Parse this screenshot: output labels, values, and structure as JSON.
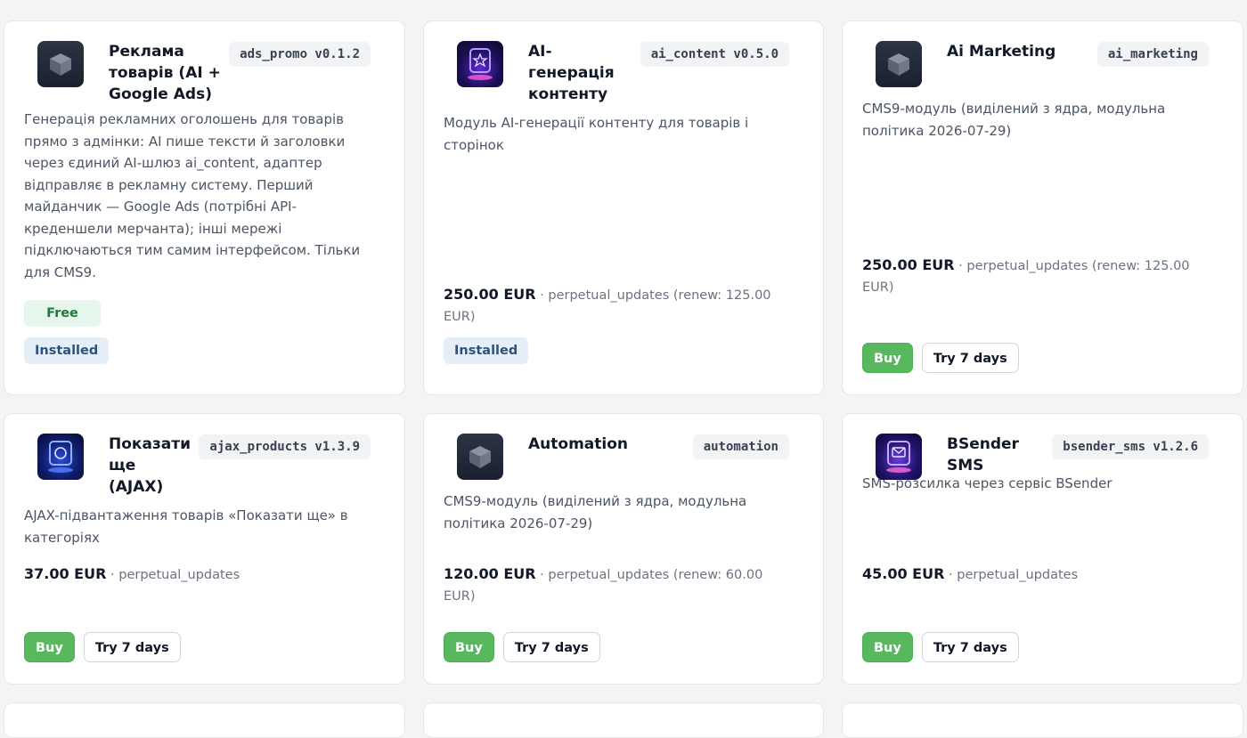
{
  "colors": {
    "page_bg": "#f4f4f5",
    "card_bg": "#ffffff",
    "buy_button": "#58b85e",
    "free_badge_bg": "#e7f6ec",
    "installed_badge_bg": "#e6eef8"
  },
  "cards": [
    {
      "title": "Реклама товарів (AI + Google Ads)",
      "slug": "ads_promo v0.1.2",
      "icon": "cube-icon",
      "description": "Генерація рекламних оголошень для товарів прямо з адмінки: AI пише тексти й заголовки через єдиний AI-шлюз ai_content, адаптер відправляє в рекламну систему. Перший майданчик — Google Ads (потрібні API-креденшели мерчанта); інші мережі підключаються тим самим інтерфейсом. Тільки для CMS9.",
      "free_label": "Free",
      "status": "Installed"
    },
    {
      "title": "AI-генерація контенту",
      "slug": "ai_content v0.5.0",
      "icon": "neon-star-icon",
      "description": "Модуль AI-генерації контенту для товарів і сторінок",
      "price": "250.00 EUR",
      "license": "· perpetual_updates (renew: 125.00 EUR)",
      "status": "Installed"
    },
    {
      "title": "Ai Marketing",
      "slug": "ai_marketing",
      "icon": "cube-icon",
      "description": "CMS9-модуль (виділений з ядра, модульна політика 2026-07-29)",
      "price": "250.00 EUR",
      "license": "· perpetual_updates (renew: 125.00 EUR)",
      "buy_label": "Buy",
      "try_label": "Try 7 days"
    },
    {
      "title": "Показати ще (AJAX)",
      "slug": "ajax_products v1.3.9",
      "icon": "neon-ring-icon",
      "description": "AJAX-підвантаження товарів «Показати ще» в категоріях",
      "price": "37.00 EUR",
      "license": "· perpetual_updates",
      "buy_label": "Buy",
      "try_label": "Try 7 days"
    },
    {
      "title": "Automation",
      "slug": "automation",
      "icon": "cube-icon",
      "description": "CMS9-модуль (виділений з ядра, модульна політика 2026-07-29)",
      "price": "120.00 EUR",
      "license": "· perpetual_updates (renew: 60.00 EUR)",
      "buy_label": "Buy",
      "try_label": "Try 7 days"
    },
    {
      "title": "BSender SMS",
      "slug": "bsender_sms v1.2.6",
      "icon": "neon-mail-icon",
      "description": "SMS-розсилка через сервіс BSender",
      "price": "45.00 EUR",
      "license": "· perpetual_updates",
      "buy_label": "Buy",
      "try_label": "Try 7 days"
    }
  ]
}
